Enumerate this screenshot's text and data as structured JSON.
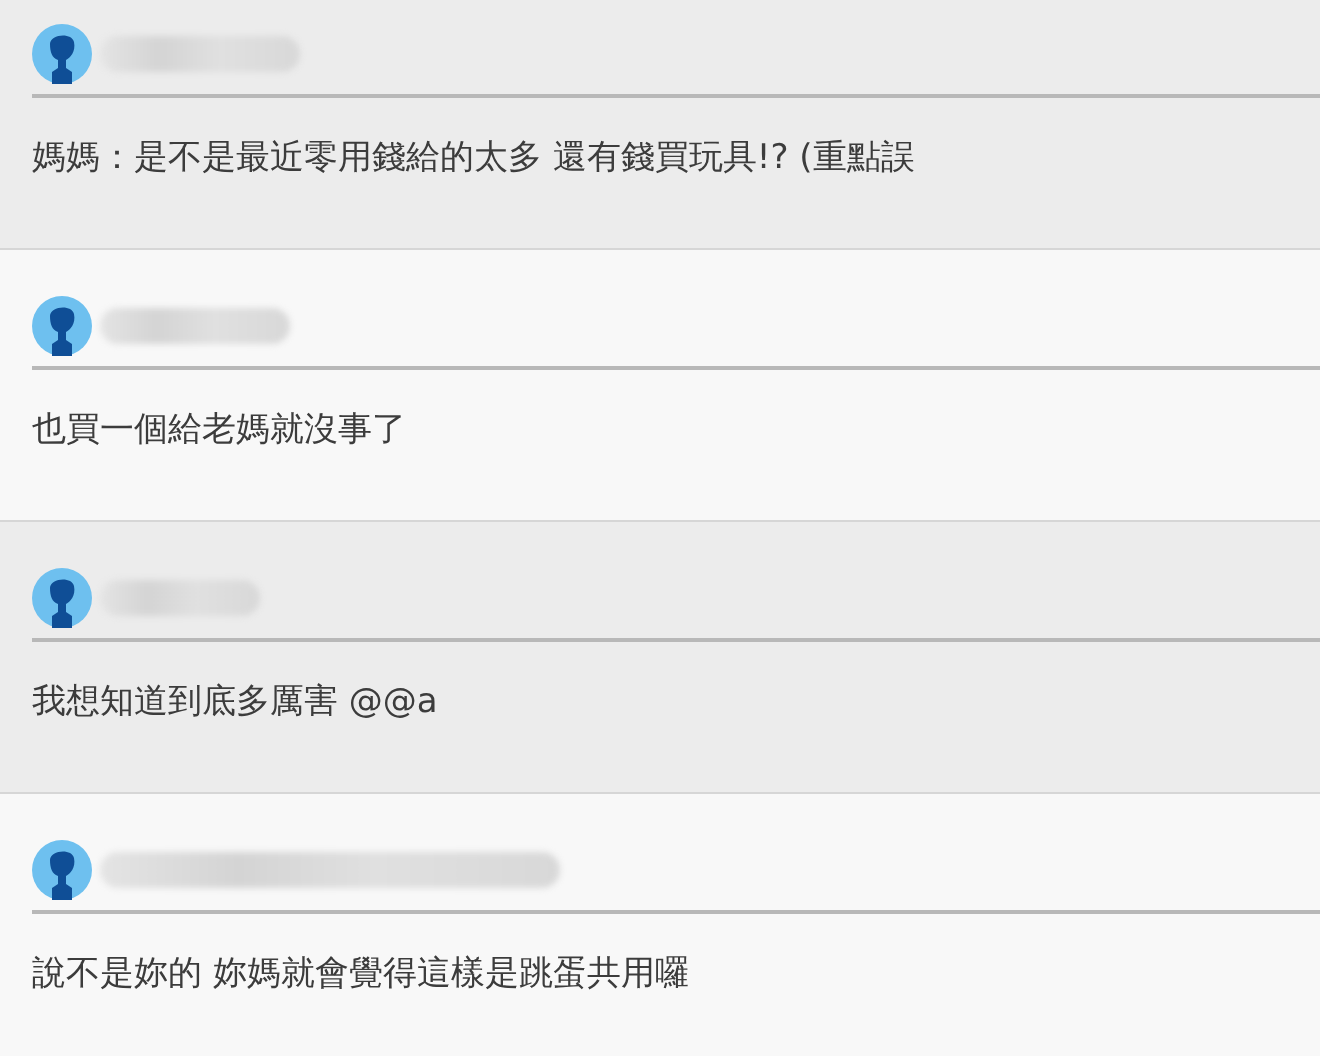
{
  "comments": [
    {
      "text": "媽媽：是不是最近零用錢給的太多 還有錢買玩具!? (重點誤"
    },
    {
      "text": "也買一個給老媽就沒事了"
    },
    {
      "text": "我想知道到底多厲害 @@a"
    },
    {
      "text": "說不是妳的 妳媽就會覺得這樣是跳蛋共用囉"
    }
  ]
}
